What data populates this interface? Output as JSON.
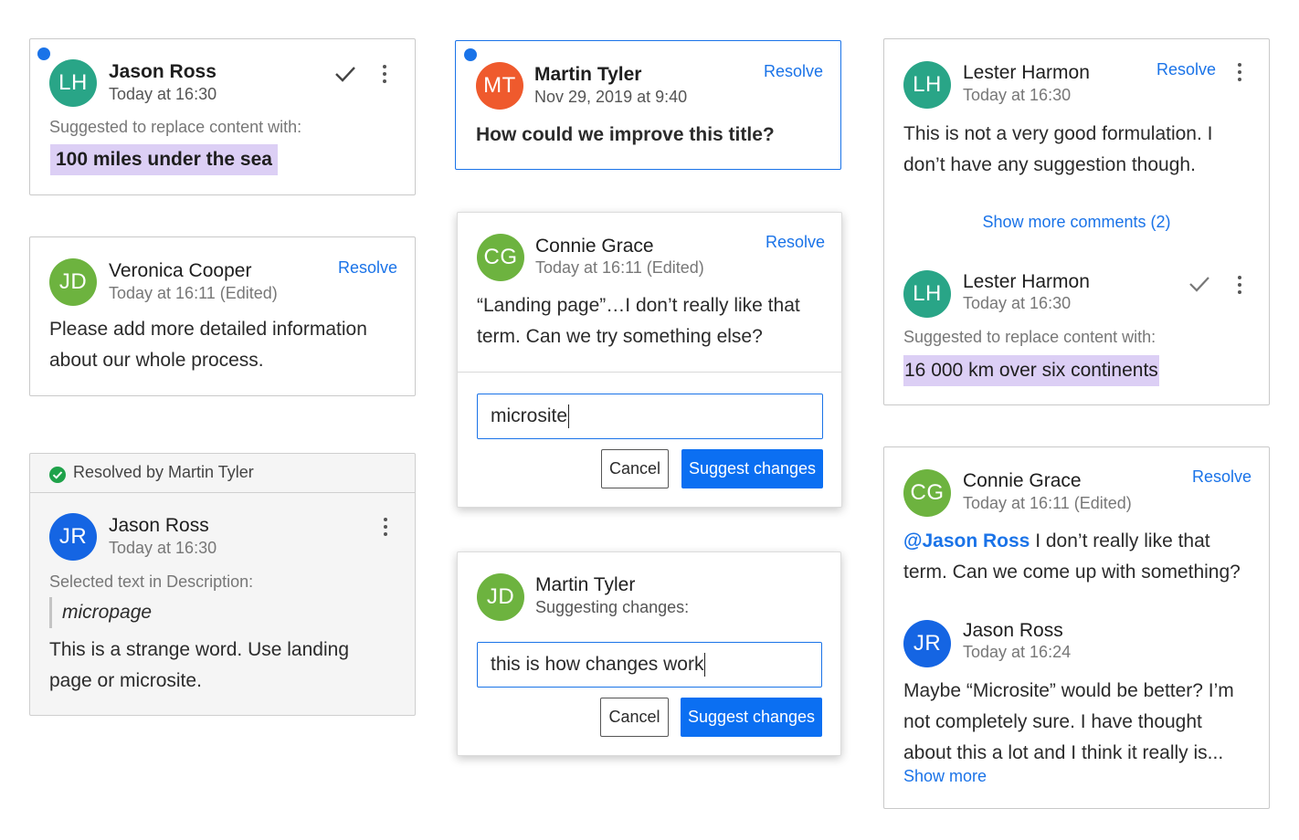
{
  "colors": {
    "accent": "#1a73e8",
    "primary_button": "#0b6ff2",
    "highlight": "#dccff5",
    "avatar_teal": "#29a587",
    "avatar_orange": "#ef5a2d",
    "avatar_green": "#6db33f",
    "avatar_blue": "#1565e3",
    "resolved_green": "#1fa24a"
  },
  "card1": {
    "avatar": "LH",
    "author": "Jason Ross",
    "time": "Today at 16:30",
    "label": "Suggested to replace content with:",
    "suggestion": "100 miles under the sea",
    "unread": true,
    "icons": [
      "check-icon",
      "more-vertical-icon"
    ]
  },
  "card2": {
    "avatar": "JD",
    "author": "Veronica Cooper",
    "time": "Today at 16:11 (Edited)",
    "resolve": "Resolve",
    "text": "Please add more detailed information about our whole process."
  },
  "card3": {
    "banner": "Resolved by Martin Tyler",
    "avatar": "JR",
    "author": "Jason Ross",
    "time": "Today at 16:30",
    "label": "Selected text in Description:",
    "quote": "micropage",
    "text": "This is a strange word. Use landing page or microsite.",
    "icons": [
      "check-circle-icon",
      "more-vertical-icon"
    ]
  },
  "card4": {
    "avatar": "MT",
    "author": "Martin Tyler",
    "time": "Nov 29, 2019 at 9:40",
    "resolve": "Resolve",
    "text": "How could we improve this title?",
    "unread": true
  },
  "card5": {
    "avatar": "CG",
    "author": "Connie Grace",
    "time": "Today at 16:11 (Edited)",
    "resolve": "Resolve",
    "text": "“Landing page”…I don’t really like that term. Can we try something else?",
    "input_value": "microsite",
    "cancel": "Cancel",
    "suggest": "Suggest changes"
  },
  "card6": {
    "avatar": "JD",
    "author": "Martin Tyler",
    "subtitle": "Suggesting changes:",
    "input_value": "this is how changes work",
    "cancel": "Cancel",
    "suggest": "Suggest changes"
  },
  "card7": {
    "resolve": "Resolve",
    "first": {
      "avatar": "LH",
      "author": "Lester Harmon",
      "time": "Today at 16:30",
      "text": "This is not a very good formulation. I don’t have any suggestion though."
    },
    "show_more_comments": "Show more comments (2)",
    "second": {
      "avatar": "LH",
      "author": "Lester Harmon",
      "time": "Today at 16:30",
      "label": "Suggested to replace content with:",
      "suggestion": "16 000 km over six continents"
    },
    "icons": [
      "more-vertical-icon",
      "check-icon"
    ]
  },
  "card8": {
    "resolve": "Resolve",
    "first": {
      "avatar": "CG",
      "author": "Connie Grace",
      "time": "Today at 16:11 (Edited)",
      "mention": "@Jason Ross",
      "text": " I don’t really like that term. Can we come up with something?"
    },
    "second": {
      "avatar": "JR",
      "author": "Jason Ross",
      "time": "Today at 16:24",
      "text": "Maybe “Microsite” would be better? I’m not completely sure. I have thought about this a lot and I think it really is...",
      "show_more": "Show more"
    }
  }
}
